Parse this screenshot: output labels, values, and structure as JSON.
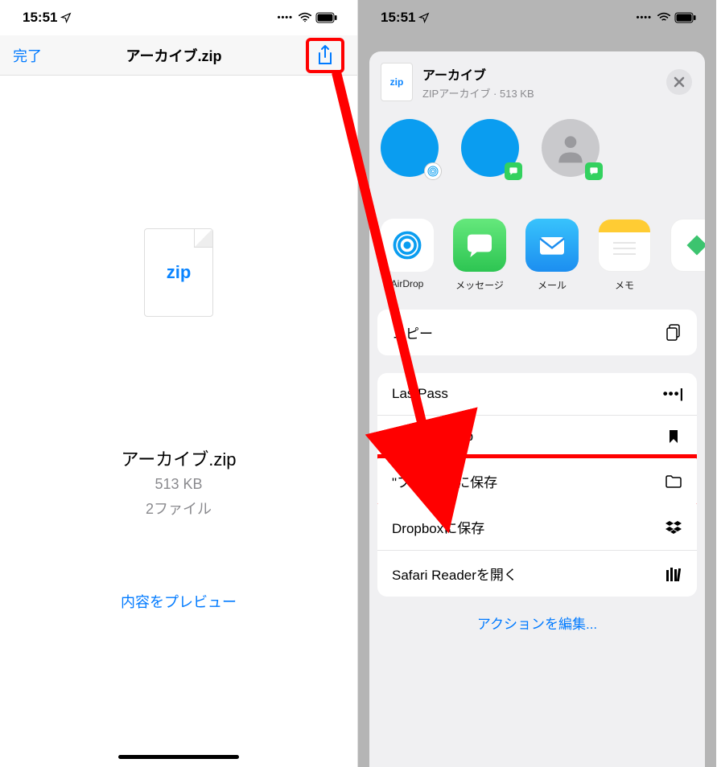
{
  "status": {
    "time": "15:51"
  },
  "left": {
    "nav": {
      "done": "完了",
      "title": "アーカイブ.zip"
    },
    "zip_label": "zip",
    "file_name": "アーカイブ.zip",
    "file_size": "513 KB",
    "file_count": "2ファイル",
    "preview": "内容をプレビュー"
  },
  "right": {
    "sheet": {
      "zip_label": "zip",
      "title": "アーカイブ",
      "subtitle": "ZIPアーカイブ · 513 KB"
    },
    "apps": {
      "airdrop": "AirDrop",
      "messages": "メッセージ",
      "mail": "メール",
      "memo": "メモ"
    },
    "actions": {
      "copy": "コピー",
      "lastpass": "LastPass",
      "keep": "Save in Keep",
      "save_files": "\"ファイル\"に保存",
      "dropbox": "Dropboxに保存",
      "safari": "Safari Readerを開く",
      "edit": "アクションを編集..."
    }
  }
}
